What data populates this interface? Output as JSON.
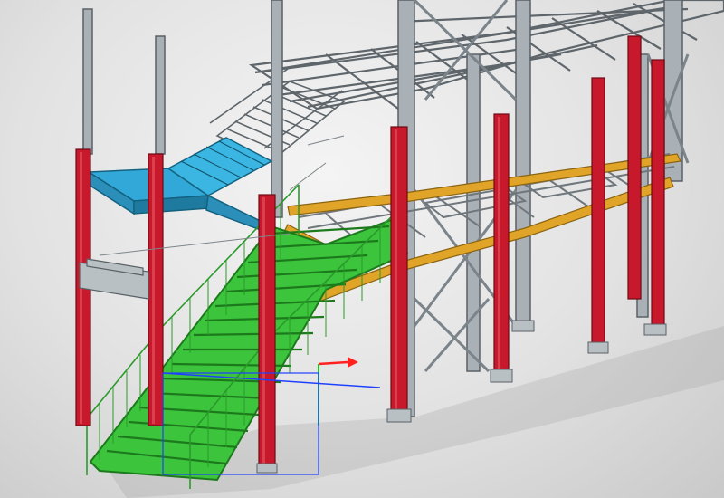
{
  "viewport": {
    "background_top": "#f4f4f4",
    "background_bottom": "#c9c9c9"
  },
  "scene": {
    "objects": [
      {
        "kind": "steel-column",
        "color": "#c8182b"
      },
      {
        "kind": "steel-frame-member",
        "color": "#9aa2a8"
      },
      {
        "kind": "stair-flight",
        "color": "#2fb82f"
      },
      {
        "kind": "stair-landing",
        "color": "#32a8d8"
      },
      {
        "kind": "walkway-beam",
        "color": "#e0a528"
      },
      {
        "kind": "upper-platform-frame",
        "color": "#6f777c"
      }
    ]
  },
  "axis_gizmo": {
    "x_color": "#ff2020",
    "y_color": "#20c020",
    "z_color": "#2040ff"
  }
}
